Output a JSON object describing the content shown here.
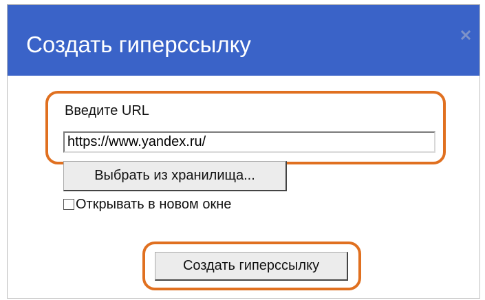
{
  "dialog": {
    "title": "Создать гиперссылку",
    "close_icon": "close-icon",
    "colors": {
      "titlebar": "#3a63c8",
      "highlight": "#e07020"
    }
  },
  "url": {
    "label": "Введите URL",
    "value": "https://www.yandex.ru/"
  },
  "storage_button_label": "Выбрать из хранилища...",
  "new_window": {
    "label": "Открывать в новом окне",
    "checked": false
  },
  "create_button_label": "Создать гиперссылку"
}
